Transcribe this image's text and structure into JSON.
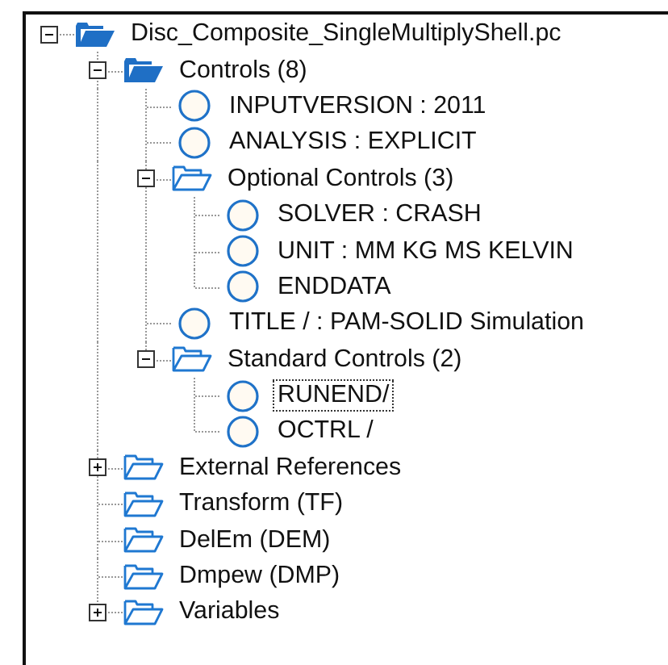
{
  "tree": [
    {
      "label": "Disc_Composite_SingleMultiplyShell.pc",
      "kind": "solid-folder",
      "expanded": true,
      "focused": false,
      "children": [
        {
          "label": "Controls (8)",
          "kind": "solid-folder",
          "expanded": true,
          "focused": false,
          "children": [
            {
              "label": "INPUTVERSION : 2011",
              "kind": "item",
              "focused": false
            },
            {
              "label": "ANALYSIS : EXPLICIT",
              "kind": "item",
              "focused": false
            },
            {
              "label": "Optional Controls (3)",
              "kind": "folder",
              "expanded": true,
              "focused": false,
              "children": [
                {
                  "label": "SOLVER : CRASH",
                  "kind": "item",
                  "focused": false
                },
                {
                  "label": "UNIT : MM KG MS KELVIN",
                  "kind": "item",
                  "focused": false
                },
                {
                  "label": "ENDDATA",
                  "kind": "item",
                  "focused": false
                }
              ]
            },
            {
              "label": "TITLE /  : PAM-SOLID Simulation",
              "kind": "item",
              "focused": false
            },
            {
              "label": "Standard Controls (2)",
              "kind": "folder",
              "expanded": true,
              "focused": false,
              "children": [
                {
                  "label": "RUNEND/",
                  "kind": "item",
                  "focused": true
                },
                {
                  "label": "OCTRL /",
                  "kind": "item",
                  "focused": false
                }
              ]
            }
          ]
        },
        {
          "label": "External References",
          "kind": "folder",
          "expanded": false,
          "focused": false
        },
        {
          "label": "Transform (TF)",
          "kind": "folder",
          "focused": false
        },
        {
          "label": "DelEm (DEM)",
          "kind": "folder",
          "focused": false
        },
        {
          "label": "Dmpew (DMP)",
          "kind": "folder",
          "focused": false
        },
        {
          "label": "Variables",
          "kind": "folder",
          "expanded": false,
          "focused": false
        }
      ]
    }
  ]
}
